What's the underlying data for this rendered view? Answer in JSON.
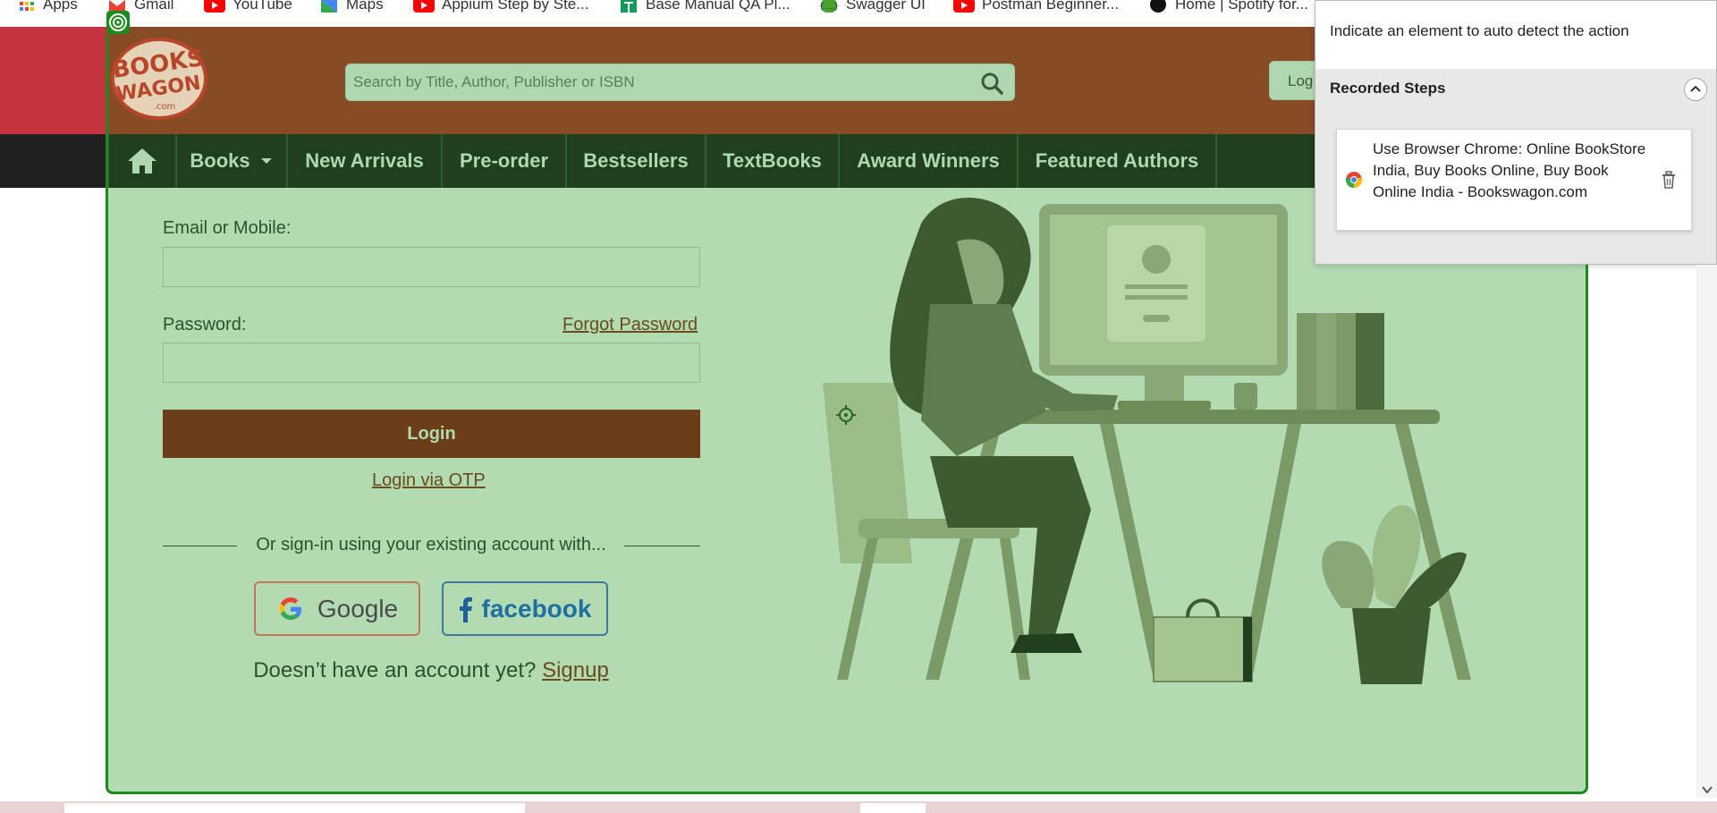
{
  "bookmarks": [
    {
      "label": "Apps",
      "icon": "apps-grid-icon",
      "color": "#4285f4"
    },
    {
      "label": "Gmail",
      "icon": "gmail-icon",
      "color": "#ea4335"
    },
    {
      "label": "YouTube",
      "icon": "youtube-icon",
      "color": "#ff0000"
    },
    {
      "label": "Maps",
      "icon": "maps-icon",
      "color": "#34a853"
    },
    {
      "label": "Appium Step by Ste...",
      "icon": "youtube-icon",
      "color": "#ff0000"
    },
    {
      "label": "Base Manual QA Pl...",
      "icon": "sheets-icon",
      "color": "#0f9d58"
    },
    {
      "label": "Swagger UI",
      "icon": "swagger-icon",
      "color": "#49a32b"
    },
    {
      "label": "Postman Beginner...",
      "icon": "youtube-icon",
      "color": "#ff0000"
    },
    {
      "label": "Home | Spotify for...",
      "icon": "spotify-icon",
      "color": "#111111"
    }
  ],
  "header": {
    "logo_line1": "BOOKS",
    "logo_line2": "WAGON",
    "logo_line3": ".com",
    "search_placeholder": "Search by Title, Author, Publisher or ISBN",
    "login_label": "Log"
  },
  "nav": {
    "items": [
      {
        "label": "Books"
      },
      {
        "label": "New Arrivals"
      },
      {
        "label": "Pre-order"
      },
      {
        "label": "Bestsellers"
      },
      {
        "label": "TextBooks"
      },
      {
        "label": "Award Winners"
      },
      {
        "label": "Featured Authors"
      }
    ]
  },
  "login_form": {
    "email_label": "Email or Mobile:",
    "password_label": "Password:",
    "forgot_password": "Forgot Password",
    "login_button": "Login",
    "login_via_otp": "Login via OTP",
    "divider_text": "Or sign-in using your existing account with...",
    "google_label": "Google",
    "facebook_label": "facebook",
    "no_account_text": "Doesn’t have an account yet?",
    "signup_link": "Signup"
  },
  "recorder": {
    "hint": "Indicate an element to auto detect the action",
    "steps_title": "Recorded Steps",
    "step_text": "Use Browser Chrome: Online BookStore India, Buy Books Online, Buy Book Online India - Bookswagon.com"
  },
  "colors": {
    "header_brown": "#874b25",
    "nav_green": "#1f3f1f",
    "overlay_green": "#b2dbb2",
    "highlight_border": "#1d8a1d",
    "login_button": "#6b3d18"
  }
}
